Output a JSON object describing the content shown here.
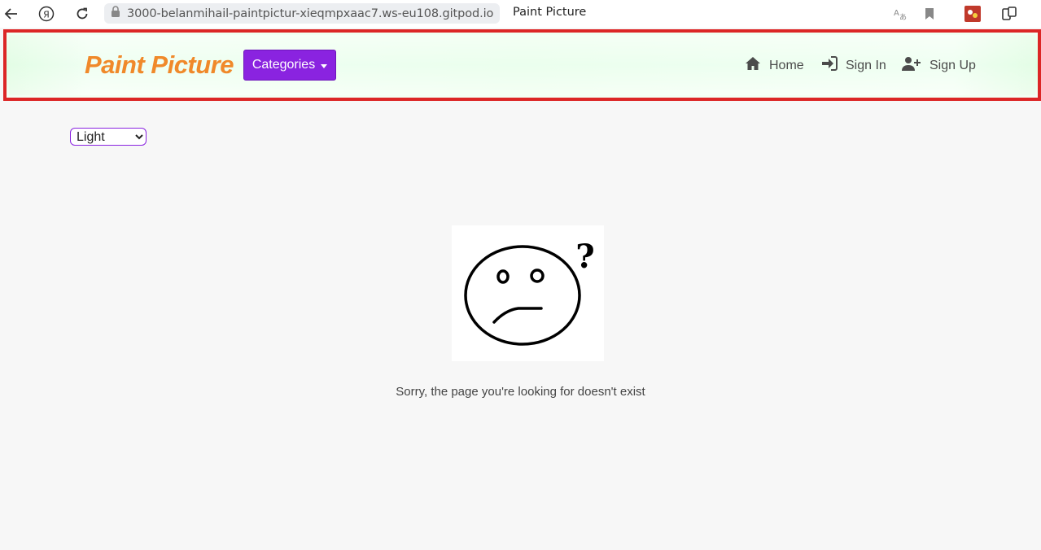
{
  "browser": {
    "url": "3000-belanmihail-paintpictur-xieqmpxaac7.ws-eu108.gitpod.io",
    "tab_title": "Paint Picture",
    "icons": [
      "back-arrow-icon",
      "yandex-icon",
      "reload-icon",
      "lock-icon",
      "translate-icon",
      "bookmark-icon",
      "extension-icon",
      "collections-icon"
    ]
  },
  "navbar": {
    "brand": "Paint Picture",
    "categories_label": "Categories",
    "links": [
      {
        "label": "Home",
        "icon": "home-icon"
      },
      {
        "label": "Sign In",
        "icon": "sign-in-icon"
      },
      {
        "label": "Sign Up",
        "icon": "user-plus-icon"
      }
    ],
    "colors": {
      "brand": "#f0892a",
      "button": "#8a23e0",
      "border": "#dc2626"
    }
  },
  "theme_select": {
    "selected": "Light"
  },
  "error": {
    "message": "Sorry, the page you're looking for doesn't exist",
    "image_icon": "confused-face-icon"
  }
}
